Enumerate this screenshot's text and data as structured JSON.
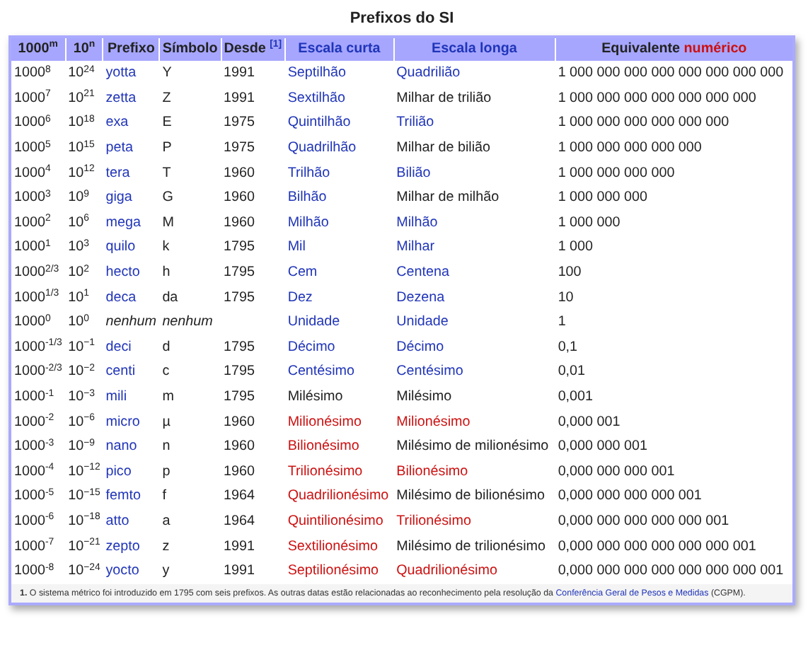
{
  "caption": "Prefixos do SI",
  "headers": [
    {
      "parts": [
        {
          "text": "1000$^{m}$",
          "kind": "plain"
        }
      ]
    },
    {
      "parts": [
        {
          "text": "10$^{n}$",
          "kind": "plain"
        }
      ]
    },
    {
      "parts": [
        {
          "text": "Prefixo",
          "kind": "plain"
        }
      ]
    },
    {
      "parts": [
        {
          "text": "Símbolo",
          "kind": "plain"
        }
      ]
    },
    {
      "parts": [
        {
          "text": "Desde",
          "kind": "plain"
        },
        {
          "text": "[1]",
          "kind": "footnote"
        }
      ]
    },
    {
      "parts": [
        {
          "text": "Escala curta",
          "kind": "link"
        }
      ]
    },
    {
      "parts": [
        {
          "text": "Escala longa",
          "kind": "link"
        }
      ]
    },
    {
      "parts": [
        {
          "text": "Equivalente",
          "kind": "plain"
        },
        {
          "text": "numérico",
          "kind": "redlink"
        }
      ]
    }
  ],
  "rows": [
    {
      "m": "1000$^{8}$",
      "n": "10$^{24}$",
      "prefix": {
        "text": "yotta",
        "kind": "link"
      },
      "symbol": {
        "text": "Y",
        "kind": "plain"
      },
      "since": "1991",
      "short": {
        "text": "Septilhão",
        "kind": "link"
      },
      "long": {
        "text": "Quadrilião",
        "kind": "link"
      },
      "value": "1 000 000 000 000 000 000 000 000"
    },
    {
      "m": "1000$^{7}$",
      "n": "10$^{21}$",
      "prefix": {
        "text": "zetta",
        "kind": "link"
      },
      "symbol": {
        "text": "Z",
        "kind": "plain"
      },
      "since": "1991",
      "short": {
        "text": "Sextilhão",
        "kind": "link"
      },
      "long": {
        "text": "Milhar de trilião",
        "kind": "plain"
      },
      "value": "1 000 000 000 000 000 000 000"
    },
    {
      "m": "1000$^{6}$",
      "n": "10$^{18}$",
      "prefix": {
        "text": "exa",
        "kind": "link"
      },
      "symbol": {
        "text": "E",
        "kind": "plain"
      },
      "since": "1975",
      "short": {
        "text": "Quintilhão",
        "kind": "link"
      },
      "long": {
        "text": "Trilião",
        "kind": "link"
      },
      "value": "1 000 000 000 000 000 000"
    },
    {
      "m": "1000$^{5}$",
      "n": "10$^{15}$",
      "prefix": {
        "text": "peta",
        "kind": "link"
      },
      "symbol": {
        "text": "P",
        "kind": "plain"
      },
      "since": "1975",
      "short": {
        "text": "Quadrilhão",
        "kind": "link"
      },
      "long": {
        "text": "Milhar de bilião",
        "kind": "plain"
      },
      "value": "1 000 000 000 000 000"
    },
    {
      "m": "1000$^{4}$",
      "n": "10$^{12}$",
      "prefix": {
        "text": "tera",
        "kind": "link"
      },
      "symbol": {
        "text": "T",
        "kind": "plain"
      },
      "since": "1960",
      "short": {
        "text": "Trilhão",
        "kind": "link"
      },
      "long": {
        "text": "Bilião",
        "kind": "link"
      },
      "value": "1 000 000 000 000"
    },
    {
      "m": "1000$^{3}$",
      "n": "10$^{9}$",
      "prefix": {
        "text": "giga",
        "kind": "link"
      },
      "symbol": {
        "text": "G",
        "kind": "plain"
      },
      "since": "1960",
      "short": {
        "text": "Bilhão",
        "kind": "link"
      },
      "long": {
        "text": "Milhar de milhão",
        "kind": "plain"
      },
      "value": "1 000 000 000"
    },
    {
      "m": "1000$^{2}$",
      "n": "10$^{6}$",
      "prefix": {
        "text": "mega",
        "kind": "link"
      },
      "symbol": {
        "text": "M",
        "kind": "plain"
      },
      "since": "1960",
      "short": {
        "text": "Milhão",
        "kind": "link"
      },
      "long": {
        "text": "Milhão",
        "kind": "link"
      },
      "value": "1 000 000"
    },
    {
      "m": "1000$^{1}$",
      "n": "10$^{3}$",
      "prefix": {
        "text": "quilo",
        "kind": "link"
      },
      "symbol": {
        "text": "k",
        "kind": "plain"
      },
      "since": "1795",
      "short": {
        "text": "Mil",
        "kind": "link"
      },
      "long": {
        "text": "Milhar",
        "kind": "link"
      },
      "value": "1 000"
    },
    {
      "m": "1000$^{2/3}$",
      "n": "10$^{2}$",
      "prefix": {
        "text": "hecto",
        "kind": "link"
      },
      "symbol": {
        "text": "h",
        "kind": "plain"
      },
      "since": "1795",
      "short": {
        "text": "Cem",
        "kind": "link"
      },
      "long": {
        "text": "Centena",
        "kind": "link"
      },
      "value": "100"
    },
    {
      "m": "1000$^{1/3}$",
      "n": "10$^{1}$",
      "prefix": {
        "text": "deca",
        "kind": "link"
      },
      "symbol": {
        "text": "da",
        "kind": "plain"
      },
      "since": "1795",
      "short": {
        "text": "Dez",
        "kind": "link"
      },
      "long": {
        "text": "Dezena",
        "kind": "link"
      },
      "value": "10"
    },
    {
      "m": "1000$^{0}$",
      "n": "10$^{0}$",
      "prefix": {
        "text": "nenhum",
        "kind": "italic"
      },
      "symbol": {
        "text": "nenhum",
        "kind": "italic"
      },
      "short": {
        "text": "Unidade",
        "kind": "link"
      },
      "long": {
        "text": "Unidade",
        "kind": "link"
      },
      "value": "1"
    },
    {
      "m": "1000$^{-1/3}$",
      "n": "10$^{−1}$",
      "prefix": {
        "text": "deci",
        "kind": "link"
      },
      "symbol": {
        "text": "d",
        "kind": "plain"
      },
      "since": "1795",
      "short": {
        "text": "Décimo",
        "kind": "link"
      },
      "long": {
        "text": "Décimo",
        "kind": "link"
      },
      "value": "0,1"
    },
    {
      "m": "1000$^{-2/3}$",
      "n": "10$^{−2}$",
      "prefix": {
        "text": "centi",
        "kind": "link"
      },
      "symbol": {
        "text": "c",
        "kind": "plain"
      },
      "since": "1795",
      "short": {
        "text": "Centésimo",
        "kind": "link"
      },
      "long": {
        "text": "Centésimo",
        "kind": "link"
      },
      "value": "0,01"
    },
    {
      "m": "1000$^{-1}$",
      "n": "10$^{−3}$",
      "prefix": {
        "text": "mili",
        "kind": "link"
      },
      "symbol": {
        "text": "m",
        "kind": "plain"
      },
      "since": "1795",
      "short": {
        "text": "Milésimo",
        "kind": "plain"
      },
      "long": {
        "text": "Milésimo",
        "kind": "plain"
      },
      "value": "0,001"
    },
    {
      "m": "1000$^{-2}$",
      "n": "10$^{−6}$",
      "prefix": {
        "text": "micro",
        "kind": "link"
      },
      "symbol": {
        "text": "µ",
        "kind": "plain"
      },
      "since": "1960",
      "short": {
        "text": "Milionésimo",
        "kind": "redlink"
      },
      "long": {
        "text": "Milionésimo",
        "kind": "redlink"
      },
      "value": "0,000 001"
    },
    {
      "m": "1000$^{-3}$",
      "n": "10$^{−9}$",
      "prefix": {
        "text": "nano",
        "kind": "link"
      },
      "symbol": {
        "text": "n",
        "kind": "plain"
      },
      "since": "1960",
      "short": {
        "text": "Bilionésimo",
        "kind": "redlink"
      },
      "long": {
        "text": "Milésimo de milionésimo",
        "kind": "plain"
      },
      "value": "0,000 000 001"
    },
    {
      "m": "1000$^{-4}$",
      "n": "10$^{−12}$",
      "prefix": {
        "text": "pico",
        "kind": "link"
      },
      "symbol": {
        "text": "p",
        "kind": "plain"
      },
      "since": "1960",
      "short": {
        "text": "Trilionésimo",
        "kind": "redlink"
      },
      "long": {
        "text": "Bilionésimo",
        "kind": "redlink"
      },
      "value": "0,000 000 000 001"
    },
    {
      "m": "1000$^{-5}$",
      "n": "10$^{−15}$",
      "prefix": {
        "text": "femto",
        "kind": "link"
      },
      "symbol": {
        "text": "f",
        "kind": "plain"
      },
      "since": "1964",
      "short": {
        "text": "Quadrilionésimo",
        "kind": "redlink"
      },
      "long": {
        "text": "Milésimo de bilionésimo",
        "kind": "plain"
      },
      "value": "0,000 000 000 000 001"
    },
    {
      "m": "1000$^{-6}$",
      "n": "10$^{−18}$",
      "prefix": {
        "text": "atto",
        "kind": "link"
      },
      "symbol": {
        "text": "a",
        "kind": "plain"
      },
      "since": "1964",
      "short": {
        "text": "Quintilionésimo",
        "kind": "redlink"
      },
      "long": {
        "text": "Trilionésimo",
        "kind": "redlink"
      },
      "value": "0,000 000 000 000 000 001"
    },
    {
      "m": "1000$^{-7}$",
      "n": "10$^{−21}$",
      "prefix": {
        "text": "zepto",
        "kind": "link"
      },
      "symbol": {
        "text": "z",
        "kind": "plain"
      },
      "since": "1991",
      "short": {
        "text": "Sextilionésimo",
        "kind": "redlink"
      },
      "long": {
        "text": "Milésimo de trilionésimo",
        "kind": "plain"
      },
      "value": "0,000 000 000 000 000 000 001"
    },
    {
      "m": "1000$^{-8}$",
      "n": "10$^{−24}$",
      "prefix": {
        "text": "yocto",
        "kind": "link"
      },
      "symbol": {
        "text": "y",
        "kind": "plain"
      },
      "since": "1991",
      "short": {
        "text": "Septilionésimo",
        "kind": "redlink"
      },
      "long": {
        "text": "Quadrilionésimo",
        "kind": "redlink"
      },
      "value": "0,000 000 000 000 000 000 000 001"
    }
  ],
  "footnote": {
    "number": "1.",
    "parts": [
      {
        "text": "O sistema métrico foi introduzido em 1795 com seis prefixos. As outras datas estão relacionadas ao reconhecimento pela resolução da",
        "kind": "plain"
      },
      {
        "text": "Conferência Geral de Pesos e Medidas",
        "kind": "link"
      },
      {
        "text": "(CGPM).",
        "kind": "plain"
      }
    ]
  }
}
